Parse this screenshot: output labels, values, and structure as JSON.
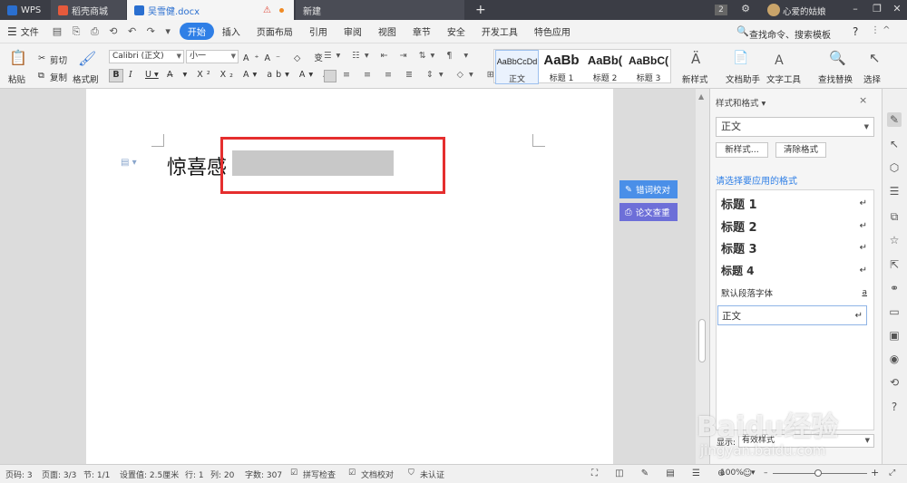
{
  "tabs": [
    {
      "label": "WPS"
    },
    {
      "label": "稻壳商城"
    },
    {
      "label": "吴雪健.docx"
    },
    {
      "label": "新建"
    }
  ],
  "tab_warning": "⚠",
  "new_tab": "+",
  "window": {
    "badge": "2",
    "user": "心爱的姑娘"
  },
  "menu": {
    "file": "文件",
    "items": [
      "开始",
      "插入",
      "页面布局",
      "引用",
      "审阅",
      "视图",
      "章节",
      "安全",
      "开发工具",
      "特色应用"
    ],
    "search": "查找命令、搜索模板",
    "help": "?"
  },
  "ribbon": {
    "paste": "粘贴",
    "cut": "剪切",
    "copy": "复制",
    "format_painter": "格式刷",
    "font": "Calibri (正文)",
    "size": "小一",
    "styles": [
      {
        "preview": "AaBbCcDd",
        "label": "正文"
      },
      {
        "preview": "AaBb",
        "label": "标题 1"
      },
      {
        "preview": "AaBb(",
        "label": "标题 2"
      },
      {
        "preview": "AaBbC(",
        "label": "标题 3"
      }
    ],
    "new_style": "新样式",
    "doc_helper": "文档助手",
    "text_tools": "文字工具",
    "find_replace": "查找替换",
    "select": "选择"
  },
  "document": {
    "text": "惊喜感"
  },
  "float_buttons": {
    "proofread": "错词校对",
    "paper_check": "论文查重"
  },
  "panel": {
    "title": "样式和格式",
    "current": "正文",
    "new_style_btn": "新样式...",
    "clear_btn": "清除格式",
    "prompt": "请选择要应用的格式",
    "items": [
      {
        "label": "标题 1",
        "mark": "↵"
      },
      {
        "label": "标题 2",
        "mark": "↵"
      },
      {
        "label": "标题 3",
        "mark": "↵"
      },
      {
        "label": "标题 4",
        "mark": "↵"
      },
      {
        "label": "默认段落字体",
        "mark": "a"
      },
      {
        "label": "正文",
        "mark": "↵"
      }
    ],
    "show_label": "显示:",
    "show_value": "有效样式"
  },
  "status": {
    "page_num": "页码: 3",
    "pages": "页面: 3/3",
    "section": "节: 1/1",
    "setting": "设置值: 2.5厘米",
    "row": "行: 1",
    "col": "列: 20",
    "words": "字数: 307",
    "spell": "拼写检查",
    "doc_check": "文档校对",
    "cert": "未认证",
    "zoom": "100%"
  },
  "watermark": {
    "brand": "Baidu经验",
    "url": "jingyan.baidu.com"
  },
  "colors": {
    "accent": "#2f7fe6",
    "titlebar": "#3b3d45",
    "red_box": "#e52e2e",
    "float_btn1": "#4a8fe8",
    "float_btn2": "#6d6fd8"
  }
}
